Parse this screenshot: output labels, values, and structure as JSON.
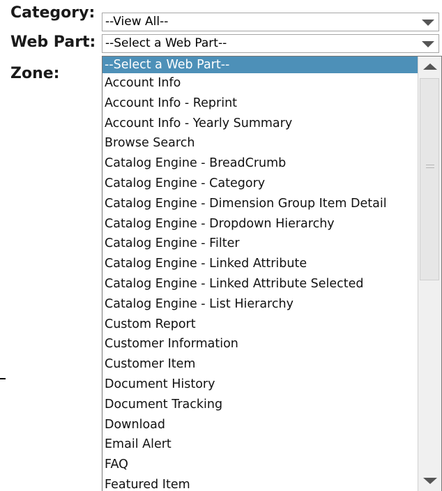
{
  "form": {
    "category_label": "Category:",
    "webpart_label": "Web Part:",
    "zone_label": "Zone:",
    "category_value": "--View All--",
    "webpart_value": "--Select a Web Part--"
  },
  "dropdown": {
    "selected_index": 0,
    "options": [
      "--Select a Web Part--",
      "Account Info",
      "Account Info - Reprint",
      "Account Info - Yearly Summary",
      "Browse Search",
      "Catalog Engine - BreadCrumb",
      "Catalog Engine - Category",
      "Catalog Engine - Dimension Group Item Detail",
      "Catalog Engine - Dropdown Hierarchy",
      "Catalog Engine - Filter",
      "Catalog Engine - Linked Attribute",
      "Catalog Engine - Linked Attribute Selected",
      "Catalog Engine - List Hierarchy",
      "Custom Report",
      "Customer Information",
      "Customer Item",
      "Document History",
      "Document Tracking",
      "Download",
      "Email Alert",
      "FAQ",
      "Featured Item"
    ]
  },
  "icons": {
    "dropdown_arrow": "chevron-down-icon",
    "scroll_up": "scroll-up-icon",
    "scroll_down": "scroll-down-icon"
  },
  "colors": {
    "selected_bg": "#4d90b8",
    "selected_text": "#ffffff",
    "arrow": "#555555"
  }
}
